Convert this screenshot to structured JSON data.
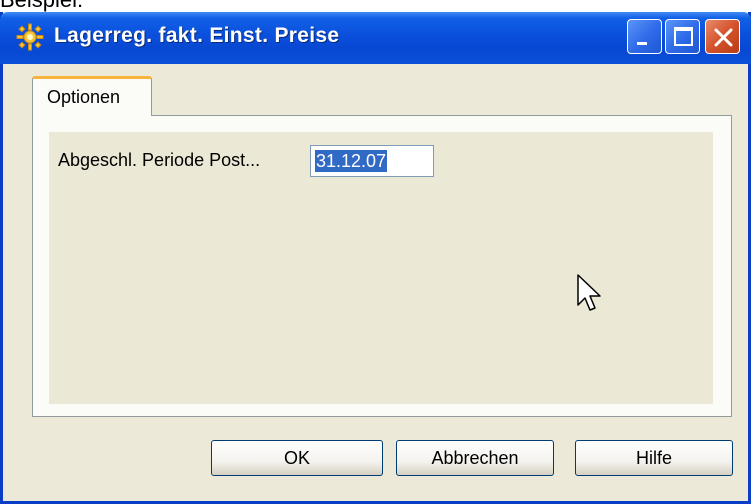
{
  "caption": "Beispiel:",
  "window": {
    "title": "Lagerreg. fakt. Einst. Preise",
    "icon": "sun-gear-icon",
    "controls": [
      "minimize",
      "maximize",
      "close"
    ]
  },
  "tabs": [
    {
      "label": "Optionen",
      "active": true
    }
  ],
  "options": {
    "field_label": "Abgeschl. Periode Post...",
    "field_value": "31.12.07"
  },
  "buttons": {
    "ok": "OK",
    "cancel": "Abbrechen",
    "help": "Hilfe"
  },
  "colors": {
    "titlebar": "#0a4fdc",
    "window_bg": "#ece9d8",
    "tab_accent": "#f7b33b",
    "selection": "#316ac5"
  }
}
